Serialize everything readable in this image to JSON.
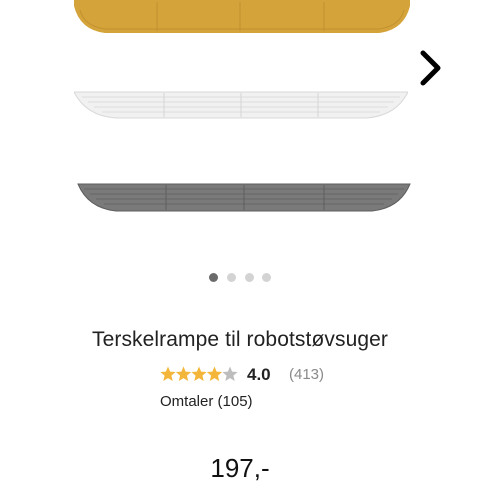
{
  "gallery": {
    "slides_count": 4,
    "active_slide": 1,
    "next_icon": "chevron-right-icon",
    "colors": {
      "yellow": "#d4a33a",
      "light": "#e6e6e6",
      "dark": "#777777"
    }
  },
  "product": {
    "title": "Terskelrampe til robotstøvsuger",
    "rating": {
      "value": "4.0",
      "count": "(413)",
      "stars_filled": 4,
      "stars_total": 5,
      "star_color": "#f4b63a",
      "star_empty_color": "#bdbdbd"
    },
    "reviews_label": "Omtaler (105)",
    "price": "197,-"
  }
}
